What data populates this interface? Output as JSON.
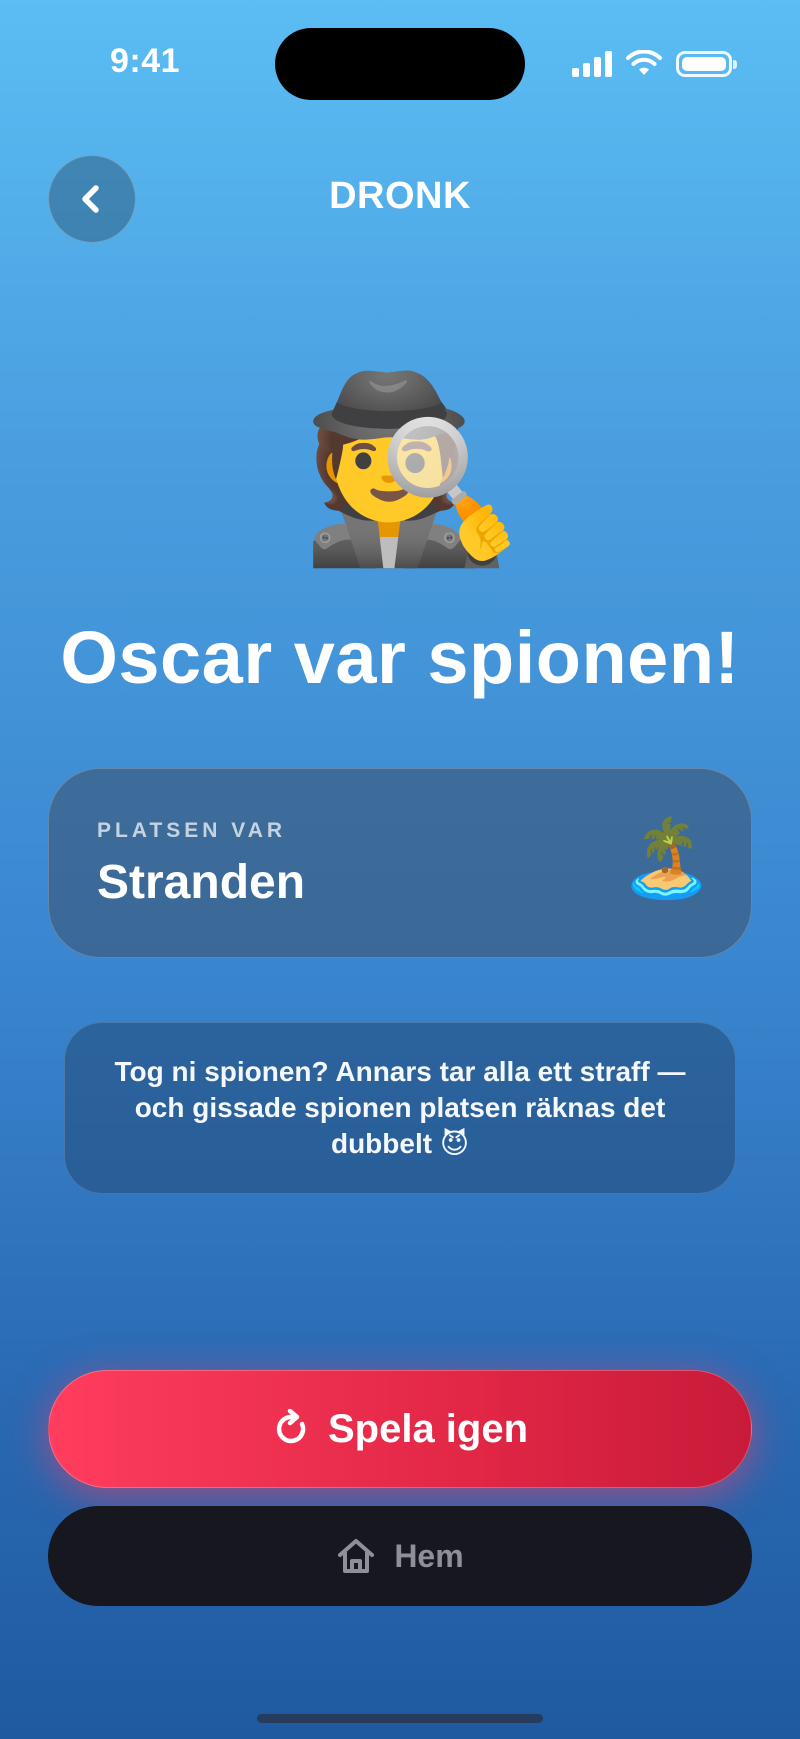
{
  "status_bar": {
    "time": "9:41"
  },
  "header": {
    "title": "DRONK"
  },
  "hero": {
    "emoji": "🕵️"
  },
  "result": {
    "headline": "Oscar var spionen!"
  },
  "place": {
    "label": "PLATSEN VAR",
    "name": "Stranden",
    "emoji": "🏝️"
  },
  "hint": {
    "text": "Tog ni spionen? Annars tar alla ett straff — och gissade spionen platsen räknas det dubbelt 😈"
  },
  "actions": {
    "play_again": "Spela igen",
    "home": "Hem"
  },
  "colors": {
    "play_button": "#e22646",
    "home_button": "#16171f",
    "background_top": "#5bbdf3",
    "background_bottom": "#1f5aa0"
  },
  "icons": {
    "back": "chevron-left-icon",
    "replay": "refresh-icon",
    "home": "house-icon"
  }
}
